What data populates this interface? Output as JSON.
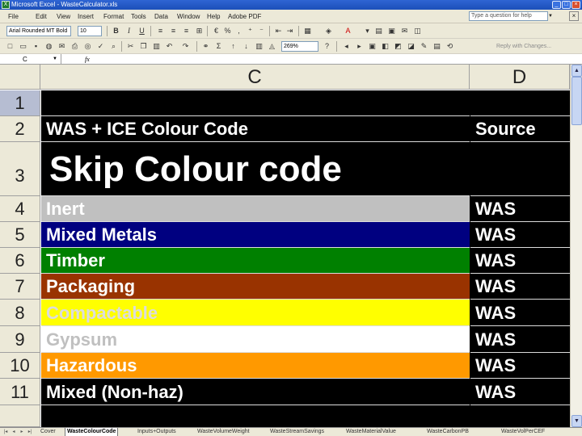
{
  "window": {
    "title": "Microsoft Excel - WasteCalculator.xls",
    "controls": [
      "_",
      "□",
      "×"
    ]
  },
  "menu": {
    "items": [
      "File",
      "Edit",
      "View",
      "Insert",
      "Format",
      "Tools",
      "Data",
      "Window",
      "Help",
      "Adobe PDF"
    ],
    "help_placeholder": "Type a question for help"
  },
  "toolbar": {
    "font_name": "Arial Rounded MT Bold",
    "font_size": "10",
    "zoom": "269%",
    "reply_text": "Reply with Changes..."
  },
  "formula_bar": {
    "name_box": "C",
    "fx": "fx",
    "content": ""
  },
  "columns": {
    "c": "C",
    "d": "D"
  },
  "rows": [
    {
      "num": "1",
      "c": "",
      "d": ""
    },
    {
      "num": "2",
      "c": "WAS + ICE Colour Code",
      "d": "Source"
    },
    {
      "num": "3",
      "c": "Skip Colour code",
      "d": ""
    },
    {
      "num": "4",
      "c": "Inert",
      "d": "WAS"
    },
    {
      "num": "5",
      "c": "Mixed Metals",
      "d": "WAS"
    },
    {
      "num": "6",
      "c": "Timber",
      "d": "WAS"
    },
    {
      "num": "7",
      "c": "Packaging",
      "d": "WAS"
    },
    {
      "num": "8",
      "c": "Compactable",
      "d": "WAS"
    },
    {
      "num": "9",
      "c": "Gypsum",
      "d": "WAS"
    },
    {
      "num": "10",
      "c": "Hazardous",
      "d": "WAS"
    },
    {
      "num": "11",
      "c": "Mixed (Non-haz)",
      "d": "WAS"
    }
  ],
  "colors": {
    "inert_bg": "#c0c0c0",
    "mixed_metals_bg": "#000080",
    "timber_bg": "#008000",
    "packaging_bg": "#993300",
    "compactable_bg": "#ffff00",
    "gypsum_bg": "#ffffff",
    "hazardous_bg": "#ff9900",
    "mixed_nonhaz_bg": "#000000",
    "header_bg": "#000000"
  },
  "tabs": [
    "Cover",
    "WasteColourCode",
    "Inputs+Outputs",
    "WasteVolumeWeight",
    "WasteStreamSavings",
    "WasteMaterialValue",
    "WasteCarbonPB",
    "WasteVolPerCEF"
  ],
  "active_tab": "WasteColourCode"
}
